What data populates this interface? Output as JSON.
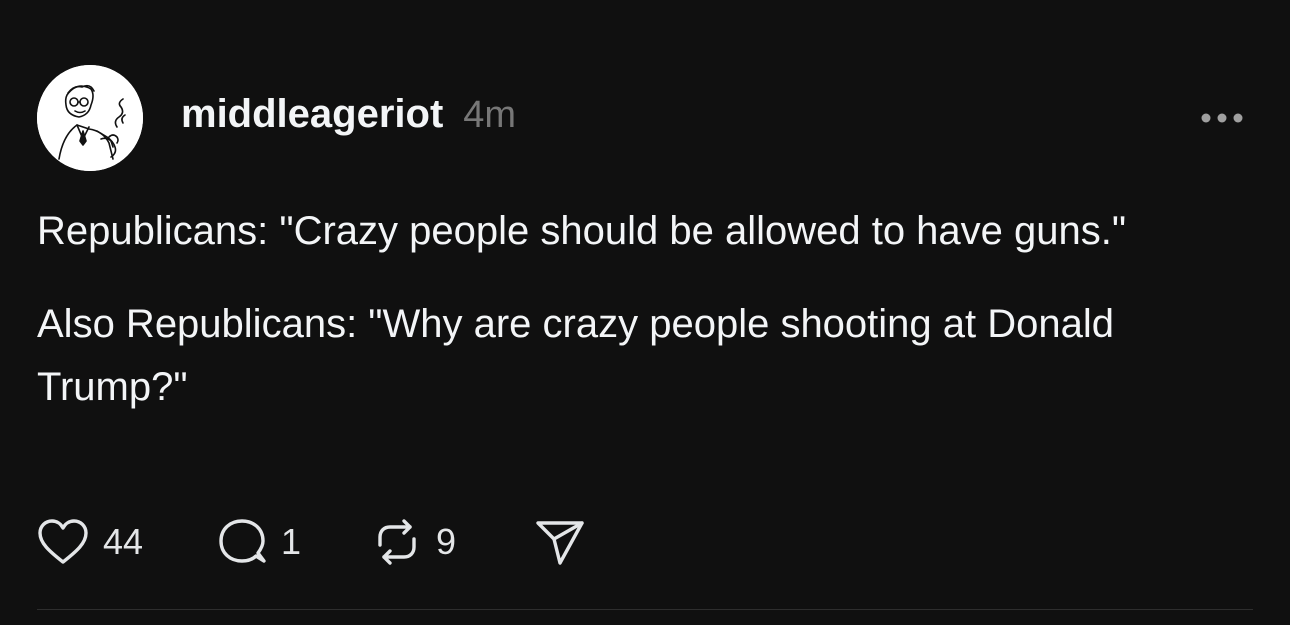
{
  "post": {
    "username": "middleageriot",
    "timestamp": "4m",
    "paragraphs": [
      "Republicans: \"Crazy people should be allowed to have guns.\"",
      "Also Republicans: \"Why are crazy people shooting at Donald Trump?\""
    ]
  },
  "actions": {
    "likes": "44",
    "replies": "1",
    "reposts": "9"
  },
  "icons": {
    "avatar": "avatar-illustration",
    "more": "more-options-icon",
    "like": "heart-icon",
    "reply": "comment-icon",
    "repost": "repost-icon",
    "share": "share-icon"
  },
  "colors": {
    "background": "#101010",
    "text": "#f3f5f7",
    "muted": "#777777",
    "divider": "#2e2e2e"
  }
}
